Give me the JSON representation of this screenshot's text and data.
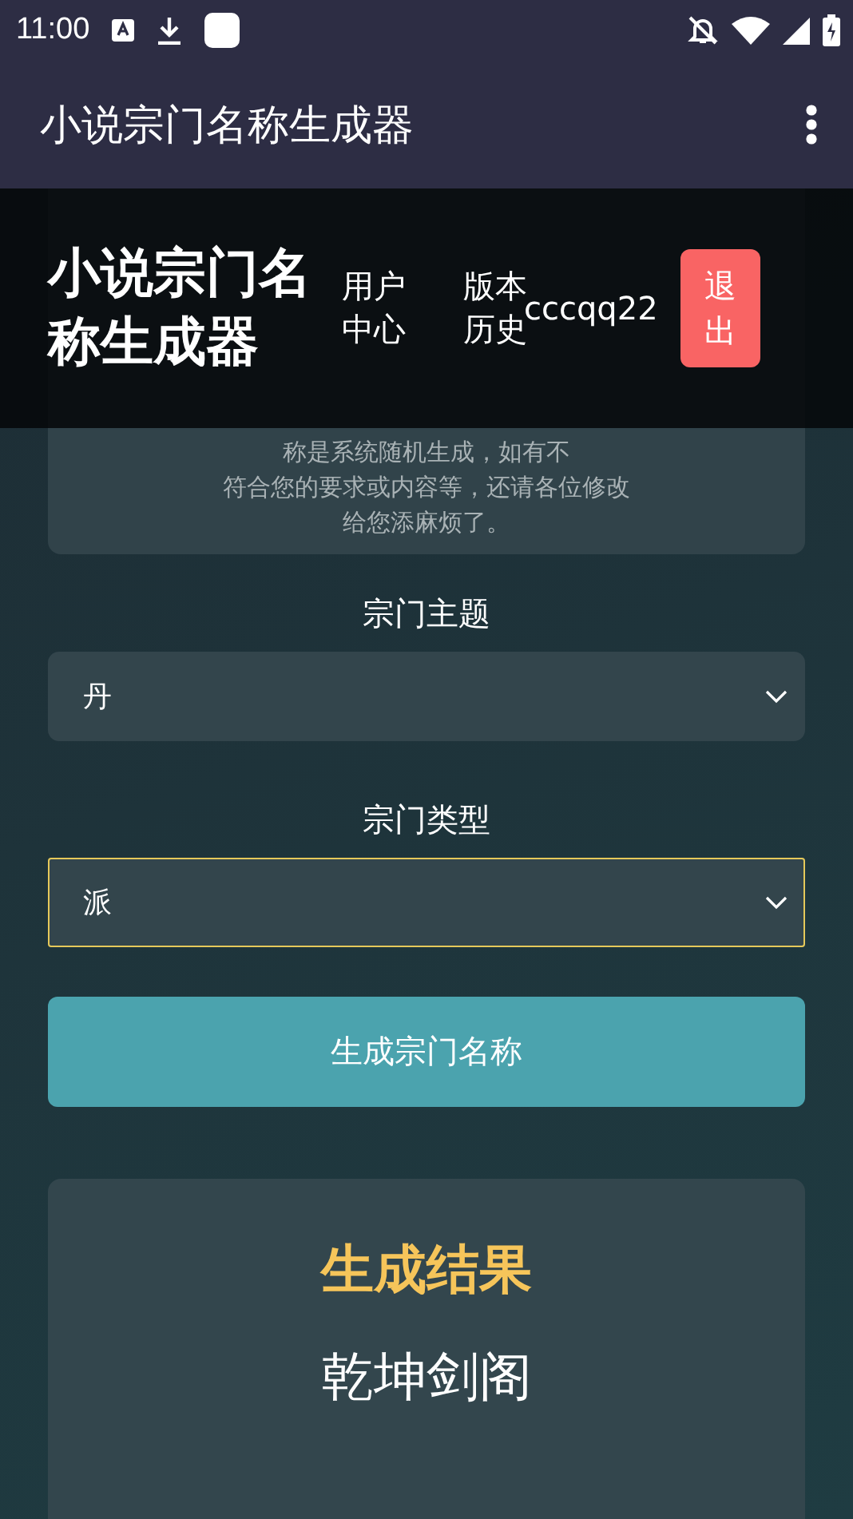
{
  "status_bar": {
    "time": "11:00"
  },
  "app_bar": {
    "title": "小说宗门名称生成器"
  },
  "overlay_header": {
    "brand": "小说宗门名称生成器",
    "links": [
      "用户中心",
      "版本历史"
    ],
    "username": "cccqq22",
    "logout": "退出"
  },
  "notice": {
    "lines": [
      "称是系统随机生成，如有不",
      "符合您的要求或内容等，还请各位修改",
      "给您添麻烦了。"
    ]
  },
  "form": {
    "fields": [
      {
        "label": "宗门主题",
        "value": "丹",
        "focused": false
      },
      {
        "label": "宗门类型",
        "value": "派",
        "focused": true
      }
    ],
    "button": "生成宗门名称"
  },
  "result": {
    "title": "生成结果",
    "name": "乾坤剑阁"
  }
}
